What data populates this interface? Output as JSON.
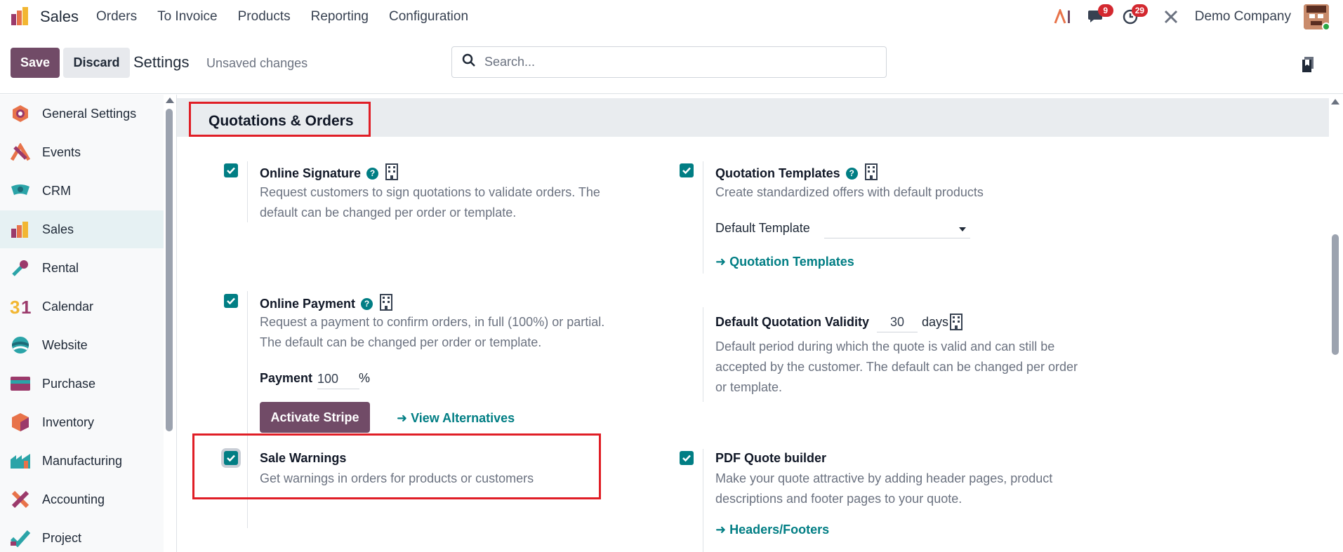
{
  "topbar": {
    "app_name": "Sales",
    "menu": [
      "Orders",
      "To Invoice",
      "Products",
      "Reporting",
      "Configuration"
    ],
    "messages_count": "9",
    "activities_count": "29",
    "company": "Demo Company"
  },
  "control_panel": {
    "save_label": "Save",
    "discard_label": "Discard",
    "title": "Settings",
    "status": "Unsaved changes",
    "search_placeholder": "Search..."
  },
  "sidebar": {
    "items": [
      {
        "label": "General Settings",
        "icon": "general-settings-icon"
      },
      {
        "label": "Events",
        "icon": "events-icon"
      },
      {
        "label": "CRM",
        "icon": "crm-icon"
      },
      {
        "label": "Sales",
        "icon": "sales-icon",
        "active": true
      },
      {
        "label": "Rental",
        "icon": "rental-icon"
      },
      {
        "label": "Calendar",
        "icon": "calendar-icon"
      },
      {
        "label": "Website",
        "icon": "website-icon"
      },
      {
        "label": "Purchase",
        "icon": "purchase-icon"
      },
      {
        "label": "Inventory",
        "icon": "inventory-icon"
      },
      {
        "label": "Manufacturing",
        "icon": "manufacturing-icon"
      },
      {
        "label": "Accounting",
        "icon": "accounting-icon"
      },
      {
        "label": "Project",
        "icon": "project-icon"
      }
    ]
  },
  "section": {
    "title": "Quotations & Orders"
  },
  "settings": {
    "online_signature": {
      "title": "Online Signature",
      "desc_1": "Request customers to sign quotations to validate orders. The",
      "desc_2": "default can be changed per order or template.",
      "checked": true
    },
    "quotation_templates": {
      "title": "Quotation Templates",
      "desc": "Create standardized offers with default products",
      "field_label": "Default Template",
      "field_value": "",
      "link": "Quotation Templates",
      "checked": true
    },
    "online_payment": {
      "title": "Online Payment",
      "desc_1": "Request a payment to confirm orders, in full (100%) or partial.",
      "desc_2": "The default can be changed per order or template.",
      "payment_label": "Payment",
      "payment_value": "100",
      "payment_unit": "%",
      "stripe_button": "Activate Stripe",
      "alternatives_link": "View Alternatives",
      "checked": true
    },
    "quotation_validity": {
      "title": "Default Quotation Validity",
      "value": "30",
      "unit": "days",
      "desc_1": "Default period during which the quote is valid and can still be",
      "desc_2": "accepted by the customer. The default can be changed per order",
      "desc_3": "or template."
    },
    "sale_warnings": {
      "title": "Sale Warnings",
      "desc": "Get warnings in orders for products or customers",
      "checked": true
    },
    "pdf_quote_builder": {
      "title": "PDF Quote builder",
      "desc_1": "Make your quote attractive by adding header pages, product",
      "desc_2": "descriptions and footer pages to your quote.",
      "link": "Headers/Footers",
      "checked": true
    }
  },
  "colors": {
    "brand": "#714b67",
    "accent": "#017e84",
    "highlight": "#e01e26",
    "badge": "#d3282f"
  }
}
